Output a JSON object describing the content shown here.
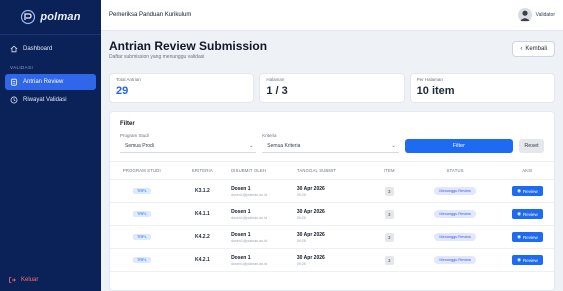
{
  "sidebar": {
    "brand": "polman",
    "items": [
      {
        "label": "Dashboard",
        "icon": "home-icon"
      },
      {
        "label": "Antrian Review",
        "icon": "clipboard-icon"
      },
      {
        "label": "Riwayat Validasi",
        "icon": "clock-icon"
      }
    ],
    "section_label": "VALIDASI",
    "logout_label": "Keluar"
  },
  "topbar": {
    "title": "Pemeriksa Panduan Kurikulum",
    "user_name": "Validator"
  },
  "page": {
    "title": "Antrian Review Submission",
    "subtitle": "Daftar submission yang menunggu validasi",
    "back_label": "Kembali"
  },
  "stats": [
    {
      "label": "Total Antrian",
      "value": "29"
    },
    {
      "label": "Halaman",
      "value": "1 / 3"
    },
    {
      "label": "Per Halaman",
      "value": "10 item"
    }
  ],
  "filter": {
    "title": "Filter",
    "prodi_label": "Program Studi",
    "prodi_value": "Semua Prodi",
    "kriteria_label": "Kriteria",
    "kriteria_value": "Semua Kriteria",
    "filter_button": "Filter",
    "reset_button": "Reset"
  },
  "table": {
    "columns": [
      "PROGRAM STUDI",
      "KRITERIA",
      "DISUBMIT OLEH",
      "TANGGAL SUBMIT",
      "ITEM",
      "STATUS",
      "AKSI"
    ],
    "rows": [
      {
        "prodi": "TRPL",
        "kriteria": "K3.1.2",
        "dosen": "Dosen 1",
        "email": "dosen1@polman.ac.id",
        "date": "30 Apr 2026",
        "time": "09:26",
        "item": "3",
        "status": "Menunggu Review",
        "action": "Review"
      },
      {
        "prodi": "TRPL",
        "kriteria": "K4.1.1",
        "dosen": "Dosen 1",
        "email": "dosen1@polman.ac.id",
        "date": "30 Apr 2026",
        "time": "09:26",
        "item": "3",
        "status": "Menunggu Review",
        "action": "Review"
      },
      {
        "prodi": "TRPL",
        "kriteria": "K4.2.2",
        "dosen": "Dosen 1",
        "email": "dosen1@polman.ac.id",
        "date": "30 Apr 2026",
        "time": "09:26",
        "item": "3",
        "status": "Menunggu Review",
        "action": "Review"
      },
      {
        "prodi": "TRPL",
        "kriteria": "K4.2.1",
        "dosen": "Dosen 1",
        "email": "dosen1@polman.ac.id",
        "date": "30 Apr 2026",
        "time": "09:26",
        "item": "3",
        "status": "Menunggu Review",
        "action": "Review"
      }
    ]
  },
  "colors": {
    "sidebar_bg": "#0b2259",
    "accent": "#1d6bf2",
    "logout": "#ff6b6b"
  }
}
